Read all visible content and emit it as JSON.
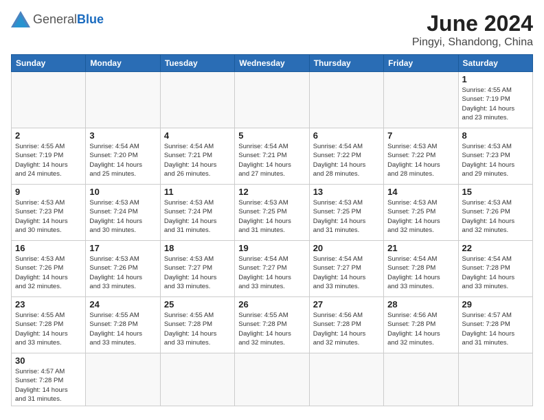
{
  "logo": {
    "general": "General",
    "blue": "Blue"
  },
  "title": "June 2024",
  "subtitle": "Pingyi, Shandong, China",
  "days_of_week": [
    "Sunday",
    "Monday",
    "Tuesday",
    "Wednesday",
    "Thursday",
    "Friday",
    "Saturday"
  ],
  "weeks": [
    [
      {
        "num": "",
        "info": ""
      },
      {
        "num": "",
        "info": ""
      },
      {
        "num": "",
        "info": ""
      },
      {
        "num": "",
        "info": ""
      },
      {
        "num": "",
        "info": ""
      },
      {
        "num": "",
        "info": ""
      },
      {
        "num": "1",
        "info": "Sunrise: 4:55 AM\nSunset: 7:19 PM\nDaylight: 14 hours\nand 23 minutes."
      }
    ],
    [
      {
        "num": "2",
        "info": "Sunrise: 4:55 AM\nSunset: 7:19 PM\nDaylight: 14 hours\nand 24 minutes."
      },
      {
        "num": "3",
        "info": "Sunrise: 4:54 AM\nSunset: 7:20 PM\nDaylight: 14 hours\nand 25 minutes."
      },
      {
        "num": "4",
        "info": "Sunrise: 4:54 AM\nSunset: 7:21 PM\nDaylight: 14 hours\nand 26 minutes."
      },
      {
        "num": "5",
        "info": "Sunrise: 4:54 AM\nSunset: 7:21 PM\nDaylight: 14 hours\nand 27 minutes."
      },
      {
        "num": "6",
        "info": "Sunrise: 4:54 AM\nSunset: 7:22 PM\nDaylight: 14 hours\nand 28 minutes."
      },
      {
        "num": "7",
        "info": "Sunrise: 4:53 AM\nSunset: 7:22 PM\nDaylight: 14 hours\nand 28 minutes."
      },
      {
        "num": "8",
        "info": "Sunrise: 4:53 AM\nSunset: 7:23 PM\nDaylight: 14 hours\nand 29 minutes."
      }
    ],
    [
      {
        "num": "9",
        "info": "Sunrise: 4:53 AM\nSunset: 7:23 PM\nDaylight: 14 hours\nand 30 minutes."
      },
      {
        "num": "10",
        "info": "Sunrise: 4:53 AM\nSunset: 7:24 PM\nDaylight: 14 hours\nand 30 minutes."
      },
      {
        "num": "11",
        "info": "Sunrise: 4:53 AM\nSunset: 7:24 PM\nDaylight: 14 hours\nand 31 minutes."
      },
      {
        "num": "12",
        "info": "Sunrise: 4:53 AM\nSunset: 7:25 PM\nDaylight: 14 hours\nand 31 minutes."
      },
      {
        "num": "13",
        "info": "Sunrise: 4:53 AM\nSunset: 7:25 PM\nDaylight: 14 hours\nand 31 minutes."
      },
      {
        "num": "14",
        "info": "Sunrise: 4:53 AM\nSunset: 7:25 PM\nDaylight: 14 hours\nand 32 minutes."
      },
      {
        "num": "15",
        "info": "Sunrise: 4:53 AM\nSunset: 7:26 PM\nDaylight: 14 hours\nand 32 minutes."
      }
    ],
    [
      {
        "num": "16",
        "info": "Sunrise: 4:53 AM\nSunset: 7:26 PM\nDaylight: 14 hours\nand 32 minutes."
      },
      {
        "num": "17",
        "info": "Sunrise: 4:53 AM\nSunset: 7:26 PM\nDaylight: 14 hours\nand 33 minutes."
      },
      {
        "num": "18",
        "info": "Sunrise: 4:53 AM\nSunset: 7:27 PM\nDaylight: 14 hours\nand 33 minutes."
      },
      {
        "num": "19",
        "info": "Sunrise: 4:54 AM\nSunset: 7:27 PM\nDaylight: 14 hours\nand 33 minutes."
      },
      {
        "num": "20",
        "info": "Sunrise: 4:54 AM\nSunset: 7:27 PM\nDaylight: 14 hours\nand 33 minutes."
      },
      {
        "num": "21",
        "info": "Sunrise: 4:54 AM\nSunset: 7:28 PM\nDaylight: 14 hours\nand 33 minutes."
      },
      {
        "num": "22",
        "info": "Sunrise: 4:54 AM\nSunset: 7:28 PM\nDaylight: 14 hours\nand 33 minutes."
      }
    ],
    [
      {
        "num": "23",
        "info": "Sunrise: 4:55 AM\nSunset: 7:28 PM\nDaylight: 14 hours\nand 33 minutes."
      },
      {
        "num": "24",
        "info": "Sunrise: 4:55 AM\nSunset: 7:28 PM\nDaylight: 14 hours\nand 33 minutes."
      },
      {
        "num": "25",
        "info": "Sunrise: 4:55 AM\nSunset: 7:28 PM\nDaylight: 14 hours\nand 33 minutes."
      },
      {
        "num": "26",
        "info": "Sunrise: 4:55 AM\nSunset: 7:28 PM\nDaylight: 14 hours\nand 32 minutes."
      },
      {
        "num": "27",
        "info": "Sunrise: 4:56 AM\nSunset: 7:28 PM\nDaylight: 14 hours\nand 32 minutes."
      },
      {
        "num": "28",
        "info": "Sunrise: 4:56 AM\nSunset: 7:28 PM\nDaylight: 14 hours\nand 32 minutes."
      },
      {
        "num": "29",
        "info": "Sunrise: 4:57 AM\nSunset: 7:28 PM\nDaylight: 14 hours\nand 31 minutes."
      }
    ],
    [
      {
        "num": "30",
        "info": "Sunrise: 4:57 AM\nSunset: 7:28 PM\nDaylight: 14 hours\nand 31 minutes."
      },
      {
        "num": "",
        "info": ""
      },
      {
        "num": "",
        "info": ""
      },
      {
        "num": "",
        "info": ""
      },
      {
        "num": "",
        "info": ""
      },
      {
        "num": "",
        "info": ""
      },
      {
        "num": "",
        "info": ""
      }
    ]
  ]
}
